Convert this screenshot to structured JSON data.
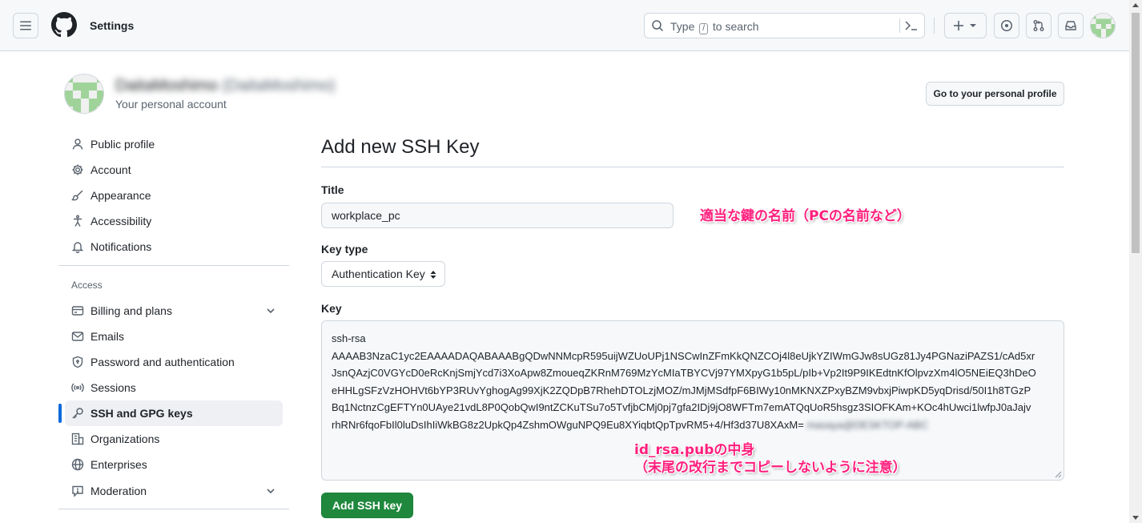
{
  "header": {
    "title": "Settings",
    "search": {
      "prefix": "Type",
      "kbd": "/",
      "suffix": "to search"
    }
  },
  "account": {
    "display_name": "DaitaMoshimo",
    "login": "(DaitaMoshimo)",
    "subtitle": "Your personal account",
    "profile_button": "Go to your personal profile"
  },
  "sidebar": {
    "items": [
      {
        "label": "Public profile"
      },
      {
        "label": "Account"
      },
      {
        "label": "Appearance"
      },
      {
        "label": "Accessibility"
      },
      {
        "label": "Notifications"
      }
    ],
    "access_heading": "Access",
    "access_items": [
      {
        "label": "Billing and plans"
      },
      {
        "label": "Emails"
      },
      {
        "label": "Password and authentication"
      },
      {
        "label": "Sessions"
      },
      {
        "label": "SSH and GPG keys"
      },
      {
        "label": "Organizations"
      },
      {
        "label": "Enterprises"
      },
      {
        "label": "Moderation"
      }
    ]
  },
  "form": {
    "heading": "Add new SSH Key",
    "title_label": "Title",
    "title_value": "workplace_pc",
    "key_type_label": "Key type",
    "key_type_value": "Authentication Key",
    "key_label": "Key",
    "key_lines": [
      "ssh-rsa",
      "AAAAB3NzaC1yc2EAAAADAQABAAABgQDwNNMcpR595uijWZUoUPj1NSCwInZFmKkQNZCOj4l8eUjkYZIWmGJw8sUGz81Jy4PGNaziPAZS1/cAd5xr",
      "JsnQAzjC0VGYcD0eRcKnjSmjYcd7i3XoApw8ZmoueqZKRnM769MzYcMIaTBYCVj97YMXpyG1b5pL/pIb+Vp2It9P9IKEdtnKfOlpvzXm4lO5NEiEQ3hDeO",
      "eHHLgSFzVzHOHVt6bYP3RUvYghogAg99XjK2ZQDpB7RhehDTOLzjMOZ/mJMjMSdfpF6BIWy10nMKNXZPxyBZM9vbxjPiwpKD5yqDrisd/50I1h8TGzP",
      "Bq1NctnzCgEFTYn0UAye21vdL8P0QobQwI9ntZCKuTSu7o5TvfjbCMj0pj7gfa2IDj9jO8WFTm7emATQqUoR5hsgz3SIOFKAm+KOc4hUwci1lwfpJ0aJajv",
      "rhRNr6fqoFbIl0luDsIhIiWkBG8z2UpkQp4ZshmOWguNPQ9Eu8XYiqbtQpTpvRM5+4/Hf3d37U8XAxM="
    ],
    "key_comment": "masaya@DESKTOP-ABC",
    "submit_label": "Add SSH key"
  },
  "annotations": {
    "title_note": "適当な鍵の名前（PCの名前など）",
    "key_note_line1": "id_rsa.pubの中身",
    "key_note_line2": "（末尾の改行までコピーしないように注意）"
  },
  "colors": {
    "primary_button": "#1f883d",
    "active_indicator": "#0969da",
    "annotation": "#ff1f7d"
  }
}
